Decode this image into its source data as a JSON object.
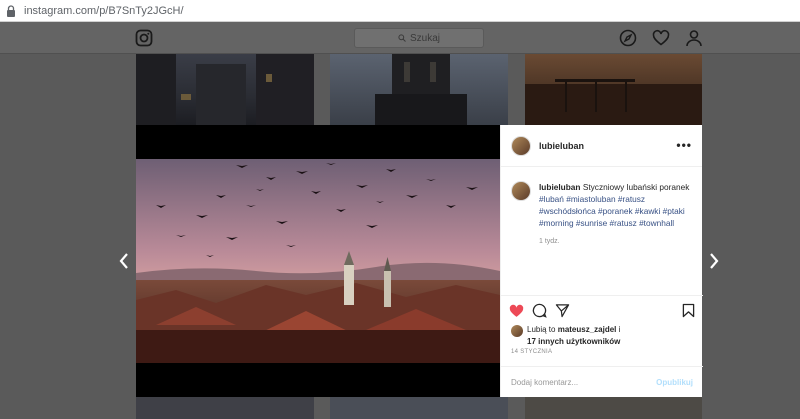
{
  "browser": {
    "url": "instagram.com/p/B7SnTy2JGcH/"
  },
  "header": {
    "search_placeholder": "Szukaj"
  },
  "post": {
    "username": "lubieluban",
    "caption_user": "lubieluban",
    "caption_text": "Styczniowy lubański poranek",
    "hashtags": "#lubań #miastoluban #ratusz #wschódsłońca #poranek #kawki #ptaki #morning #sunrise #ratusz #townhall",
    "time_ago": "1 tydz.",
    "likes_prefix": "Lubią to",
    "likes_user": "mateusz_zajdel",
    "likes_suffix": "i",
    "likes_others": "17 innych użytkowników",
    "date": "14 STYCZNIA",
    "comment_placeholder": "Dodaj komentarz...",
    "publish_label": "Opublikuj",
    "liked": true,
    "like_color": "#ed4956"
  },
  "icons": {
    "instagram": "instagram-icon",
    "explore": "compass-icon",
    "activity": "heart-icon",
    "profile": "profile-icon"
  }
}
